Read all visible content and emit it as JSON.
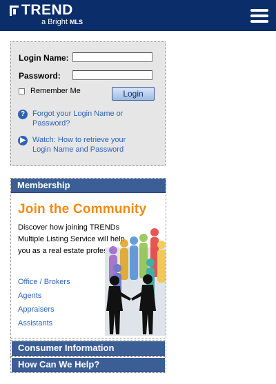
{
  "header": {
    "logo_text": "TREND",
    "logo_sub": "a Bright",
    "logo_sub_mls": "MLS",
    "menu_icon": "hamburger-menu-icon"
  },
  "login": {
    "login_name_label": "Login Name:",
    "login_name_value": "",
    "password_label": "Password:",
    "password_value": "",
    "remember_label": "Remember Me",
    "remember_checked": false,
    "login_button": "Login",
    "forgot_link": "Forgot your Login Name or Password?",
    "watch_link": "Watch: How to retrieve your Login Name and Password",
    "forgot_icon": "question-icon",
    "watch_icon": "play-icon"
  },
  "membership": {
    "header": "Membership",
    "join_title": "Join the Community",
    "description": "Discover how joining TRENDs Multiple Listing Service will help you as a real estate professional.",
    "links": [
      "Office / Brokers",
      "Agents",
      "Appraisers",
      "Assistants"
    ]
  },
  "consumer": {
    "header": "Consumer Information"
  },
  "help": {
    "header": "How Can We Help?"
  },
  "colors": {
    "header_bg": "#0b2e6b",
    "bar_bg": "#3c5e96",
    "link": "#2f62b5",
    "accent_orange": "#f08a12",
    "panel_bg": "#e6e6e6"
  }
}
